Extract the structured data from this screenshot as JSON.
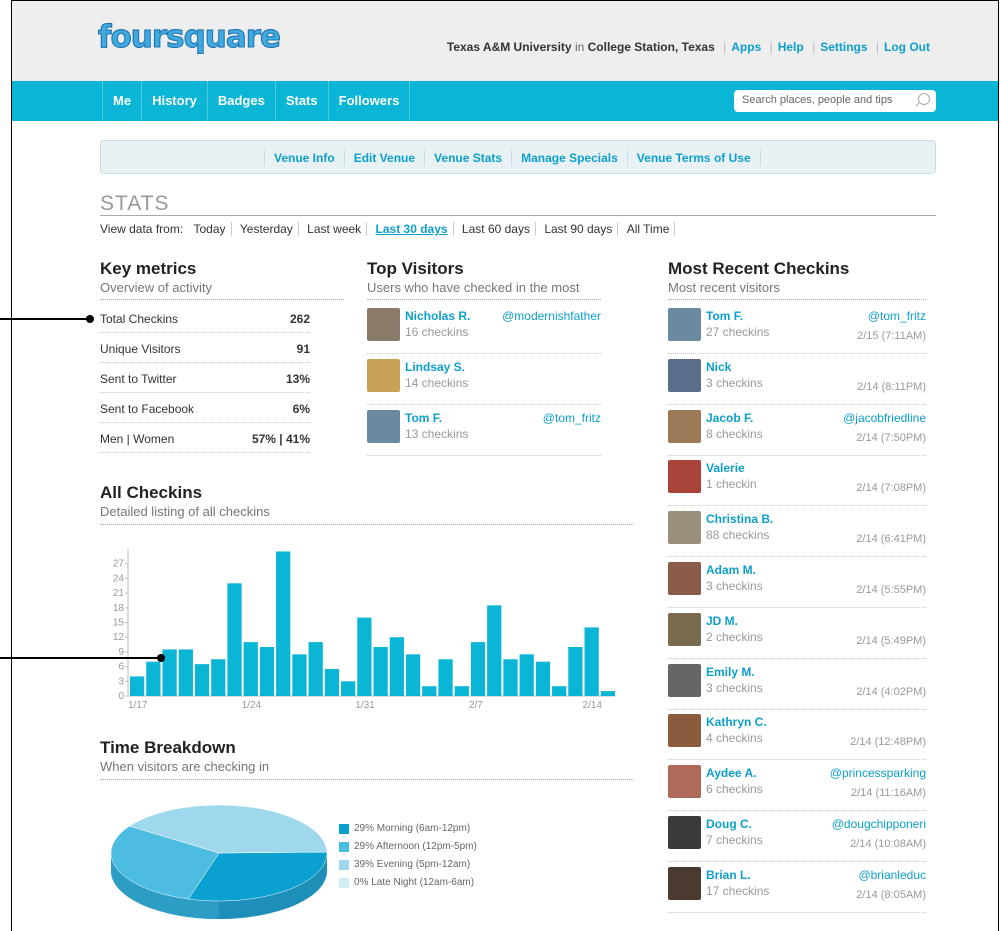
{
  "header": {
    "logo_text": "foursquare",
    "location_venue": "Texas A&M University",
    "location_in": "in",
    "location_city": "College Station, Texas",
    "links": [
      "Apps",
      "Help",
      "Settings",
      "Log Out"
    ]
  },
  "nav": {
    "items": [
      "Me",
      "History",
      "Badges",
      "Stats",
      "Followers"
    ],
    "search_placeholder": "Search places, people and tips"
  },
  "subnav": {
    "items": [
      "Venue Info",
      "Edit Venue",
      "Venue Stats",
      "Manage Specials",
      "Venue Terms of Use"
    ]
  },
  "stats": {
    "title": "STATS",
    "view_label": "View data from:",
    "ranges": [
      "Today",
      "Yesterday",
      "Last week",
      "Last 30 days",
      "Last 60 days",
      "Last 90 days",
      "All Time"
    ],
    "active_range": "Last 30 days"
  },
  "key_metrics": {
    "title": "Key metrics",
    "subtitle": "Overview of activity",
    "rows": [
      {
        "label": "Total Checkins",
        "value": "262"
      },
      {
        "label": "Unique Visitors",
        "value": "91"
      },
      {
        "label": "Sent to Twitter",
        "value": "13%"
      },
      {
        "label": "Sent to Facebook",
        "value": "6%"
      },
      {
        "label": "Men | Women",
        "value": "57% | 41%"
      }
    ]
  },
  "top_visitors": {
    "title": "Top Visitors",
    "subtitle": "Users who have checked in the most",
    "rows": [
      {
        "name": "Nicholas R.",
        "checkins": "16 checkins",
        "handle": "@modernishfather",
        "avatar_color": "#8a7a6a"
      },
      {
        "name": "Lindsay S.",
        "checkins": "14 checkins",
        "handle": "",
        "avatar_color": "#c9a25a"
      },
      {
        "name": "Tom F.",
        "checkins": "13 checkins",
        "handle": "@tom_fritz",
        "avatar_color": "#6b8aa0"
      }
    ]
  },
  "recent_checkins": {
    "title": "Most Recent Checkins",
    "subtitle": "Most recent visitors",
    "rows": [
      {
        "name": "Tom F.",
        "checkins": "27 checkins",
        "handle": "@tom_fritz",
        "time": "2/15 (7:11AM)",
        "avatar_color": "#6b8aa0"
      },
      {
        "name": "Nick",
        "checkins": "3 checkins",
        "handle": "",
        "time": "2/14 (8:11PM)",
        "avatar_color": "#5a6e8c"
      },
      {
        "name": "Jacob F.",
        "checkins": "8 checkins",
        "handle": "@jacobfriedline",
        "time": "2/14 (7:50PM)",
        "avatar_color": "#9c7a58"
      },
      {
        "name": "Valerie",
        "checkins": "1 checkin",
        "handle": "",
        "time": "2/14 (7:08PM)",
        "avatar_color": "#a8443a"
      },
      {
        "name": "Christina B.",
        "checkins": "88 checkins",
        "handle": "",
        "time": "2/14 (6:41PM)",
        "avatar_color": "#9a8f7c"
      },
      {
        "name": "Adam M.",
        "checkins": "3 checkins",
        "handle": "",
        "time": "2/14 (5:55PM)",
        "avatar_color": "#8a5a4a"
      },
      {
        "name": "JD M.",
        "checkins": "2 checkins",
        "handle": "",
        "time": "2/14 (5:49PM)",
        "avatar_color": "#7a6a50"
      },
      {
        "name": "Emily M.",
        "checkins": "3 checkins",
        "handle": "",
        "time": "2/14 (4:02PM)",
        "avatar_color": "#666666"
      },
      {
        "name": "Kathryn C.",
        "checkins": "4 checkins",
        "handle": "",
        "time": "2/14 (12:48PM)",
        "avatar_color": "#8c5a3c"
      },
      {
        "name": "Aydee A.",
        "checkins": "6 checkins",
        "handle": "@princessparking",
        "time": "2/14 (11:16AM)",
        "avatar_color": "#b06a5a"
      },
      {
        "name": "Doug C.",
        "checkins": "7 checkins",
        "handle": "@dougchipponeri",
        "time": "2/14 (10:08AM)",
        "avatar_color": "#3a3a3a"
      },
      {
        "name": "Brian L.",
        "checkins": "17 checkins",
        "handle": "@brianleduc",
        "time": "2/14 (8:05AM)",
        "avatar_color": "#4a3a30"
      }
    ]
  },
  "all_checkins": {
    "title": "All Checkins",
    "subtitle": "Detailed listing of all checkins"
  },
  "time_breakdown": {
    "title": "Time Breakdown",
    "subtitle": "When visitors are checking in",
    "legend": [
      {
        "label": "29% Morning (6am-12pm)",
        "color": "#0aa0d0"
      },
      {
        "label": "29% Afternoon (12pm-5pm)",
        "color": "#4cbde0"
      },
      {
        "label": "39% Evening (5pm-12am)",
        "color": "#9fd8ec"
      },
      {
        "label": "0% Late Night (12am-6am)",
        "color": "#d4eef7"
      }
    ]
  },
  "chart_data": [
    {
      "type": "bar",
      "yticks": [
        0,
        3,
        6,
        9,
        12,
        15,
        18,
        21,
        24,
        27
      ],
      "ylim": [
        0,
        30
      ],
      "xtick_labels": [
        {
          "label": "1/17",
          "index": 0
        },
        {
          "label": "1/24",
          "index": 7
        },
        {
          "label": "1/31",
          "index": 14
        },
        {
          "label": "2/7",
          "index": 21
        },
        {
          "label": "2/14",
          "index": 28
        }
      ],
      "values": [
        4,
        7,
        9.5,
        9.5,
        6.5,
        7.5,
        23,
        11,
        10,
        29.5,
        8.5,
        11,
        5.5,
        3,
        16,
        10,
        12,
        8.5,
        2,
        7.5,
        2,
        11,
        18.5,
        7.5,
        8.5,
        7,
        2,
        10,
        14,
        1
      ],
      "color": "#0ab5d6"
    },
    {
      "type": "pie",
      "slices": [
        {
          "label": "Morning (6am-12pm)",
          "value": 29
        },
        {
          "label": "Afternoon (12pm-5pm)",
          "value": 29
        },
        {
          "label": "Evening (5pm-12am)",
          "value": 39
        },
        {
          "label": "Late Night (12am-6am)",
          "value": 0
        }
      ]
    }
  ]
}
